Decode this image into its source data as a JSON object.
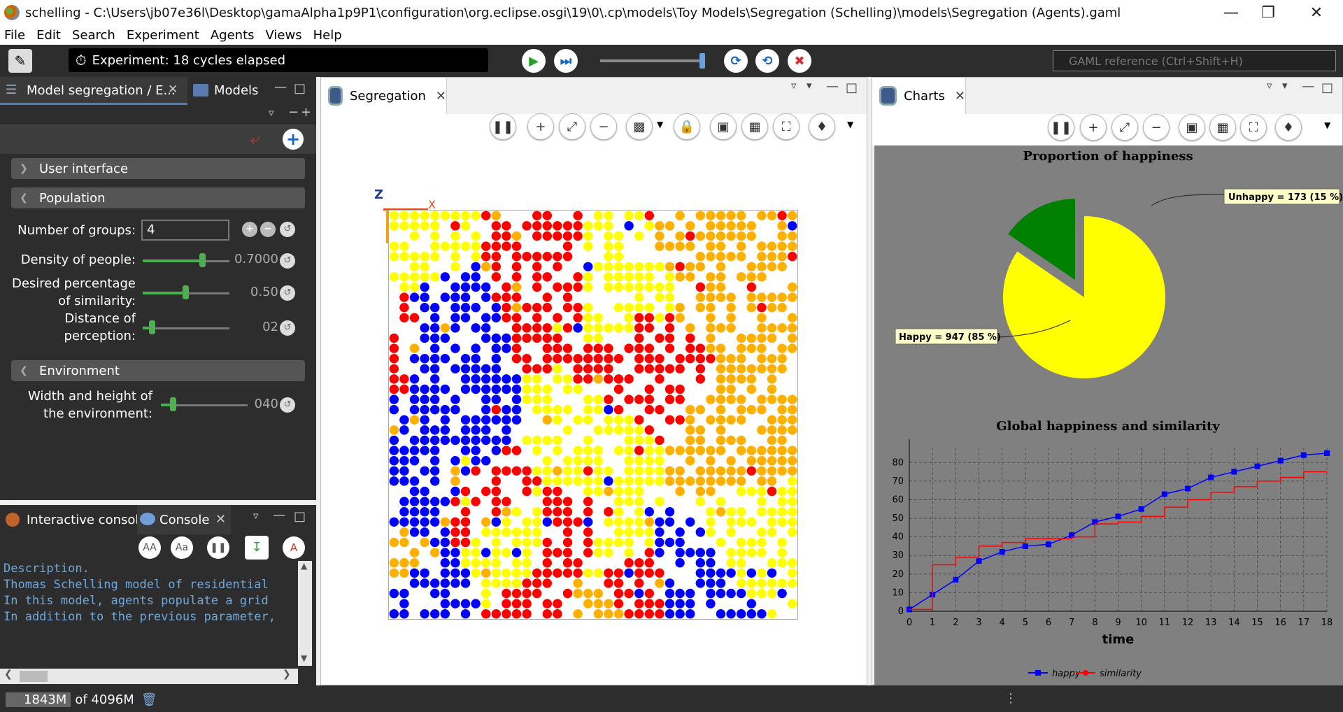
{
  "window": {
    "title": "schelling - C:\\Users\\jb07e36l\\Desktop\\gamaAlpha1p9P1\\configuration\\org.eclipse.osgi\\19\\0\\.cp\\models\\Toy Models\\Segregation (Schelling)\\models\\Segregation (Agents).gaml"
  },
  "menu": [
    "File",
    "Edit",
    "Search",
    "Experiment",
    "Agents",
    "Views",
    "Help"
  ],
  "toolbar": {
    "status": "Experiment: 18 cycles elapsed",
    "search_placeholder": "GAML reference (Ctrl+Shift+H)"
  },
  "left_panel": {
    "tabs": [
      "Model segregation / E...",
      "Models"
    ],
    "sections": {
      "user_interface": "User interface",
      "population": "Population",
      "environment": "Environment"
    },
    "params": {
      "groups_label": "Number of groups:",
      "groups_value": "4",
      "density_label": "Density of people:",
      "density_value": "0.7000",
      "density_level": 0.7,
      "similarity_label_1": "Desired percentage",
      "similarity_label_2": "of similarity:",
      "similarity_value": "0.50",
      "similarity_level": 0.5,
      "perception_label_1": "Distance of",
      "perception_label_2": "perception:",
      "perception_value": "02",
      "perception_level": 0.1,
      "size_label_1": "Width and height of",
      "size_label_2": "the environment:",
      "size_value": "040",
      "size_level": 0.1
    }
  },
  "console_panel": {
    "tabs": [
      "Interactive console",
      "Console"
    ],
    "lines": [
      "Description.",
      "Thomas Schelling model of residential",
      "In this model, agents populate a grid",
      "In addition to the previous parameter,"
    ]
  },
  "center_panel": {
    "tab": "Segregation",
    "axis_x": "X",
    "axis_z": "Z"
  },
  "right_panel": {
    "tab": "Charts"
  },
  "chart_data": [
    {
      "type": "pie",
      "title": "Proportion of happiness",
      "labels": [
        "Happy",
        "Unhappy"
      ],
      "values": [
        947,
        173
      ],
      "annotations": [
        "Happy = 947 (85 %)",
        "Unhappy = 173 (15 %)"
      ],
      "colors": [
        "#ffff00",
        "#008000"
      ]
    },
    {
      "type": "line",
      "title": "Global happiness and similarity",
      "xlabel": "time",
      "ylabel": "",
      "x": [
        0,
        1,
        2,
        3,
        4,
        5,
        6,
        7,
        8,
        9,
        10,
        11,
        12,
        13,
        14,
        15,
        16,
        17,
        18
      ],
      "xlim": [
        0,
        18
      ],
      "ylim": [
        0,
        88
      ],
      "yticks": [
        0,
        10,
        20,
        30,
        40,
        50,
        60,
        70,
        80
      ],
      "series": [
        {
          "name": "happy",
          "color": "#0000ff",
          "values": [
            1,
            9,
            17,
            27,
            32,
            35,
            36,
            41,
            48,
            51,
            55,
            63,
            66,
            72,
            75,
            78,
            81,
            84,
            85
          ]
        },
        {
          "name": "similarity",
          "color": "#ff0000",
          "values": [
            1,
            25,
            29,
            35,
            37,
            39,
            39,
            40,
            47,
            48,
            51,
            56,
            60,
            64,
            67,
            70,
            72,
            75,
            75
          ]
        }
      ],
      "legend": "bottom"
    }
  ],
  "colors": {
    "group_1": "#ff0000",
    "group_2": "#ffff00",
    "group_3": "#0000ff",
    "group_4": "#ffb000"
  },
  "bottom_bar": {
    "memory_used": "1843M",
    "memory_of": "of 4096M"
  }
}
